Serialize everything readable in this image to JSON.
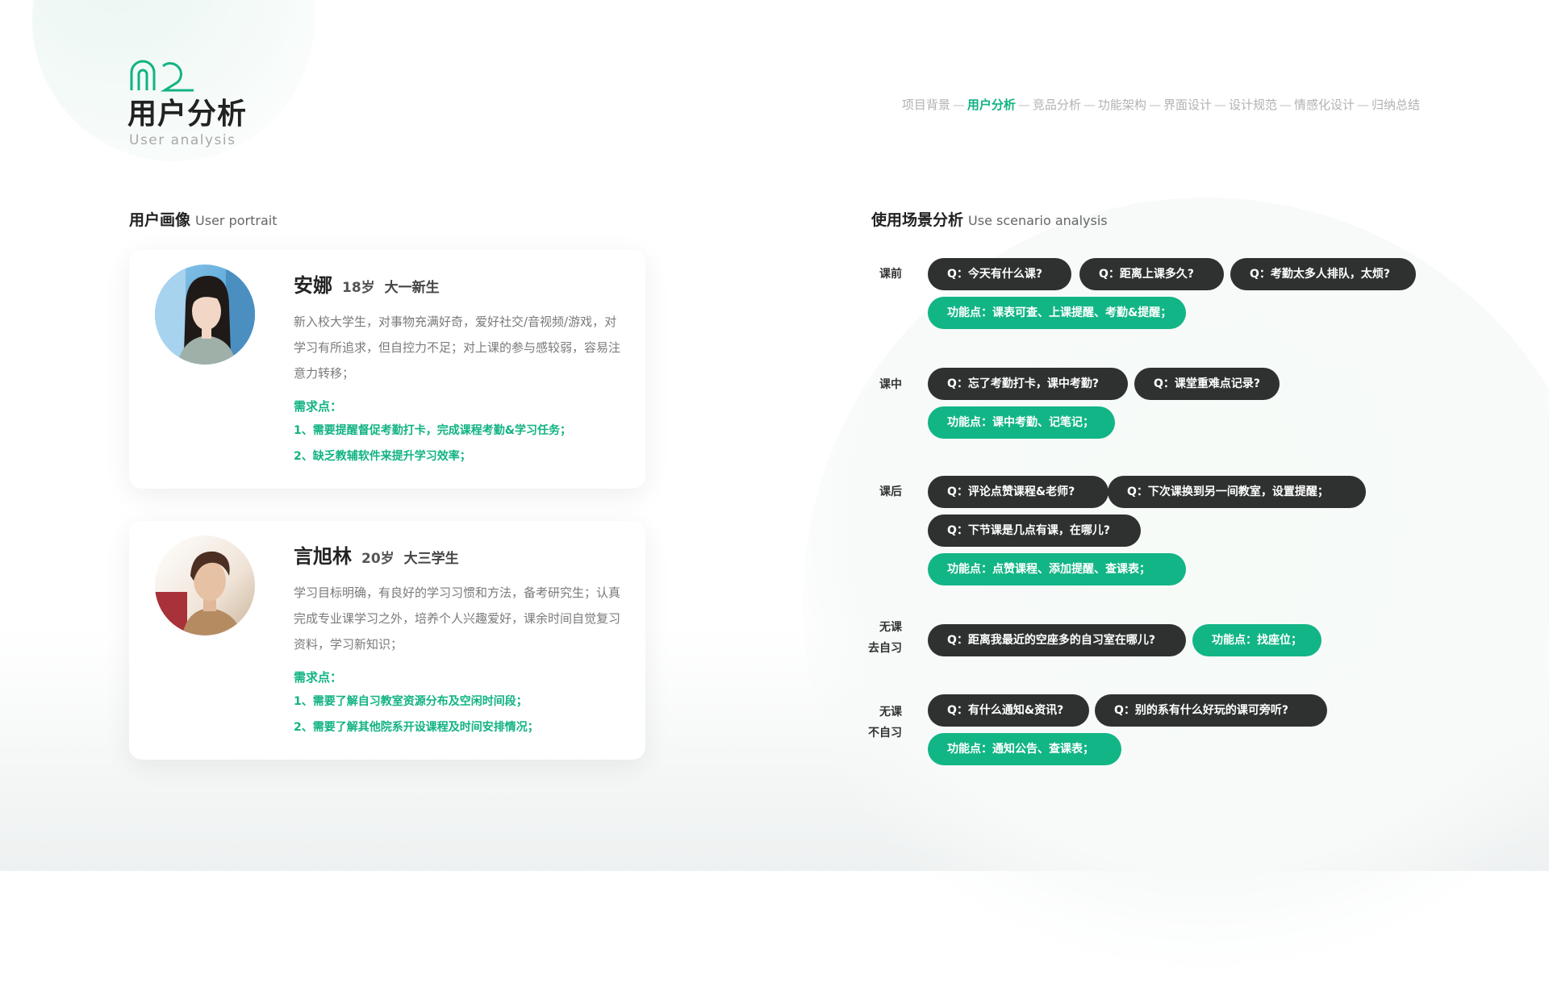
{
  "section": {
    "number": "02",
    "title": "用户分析",
    "subtitle": "User analysis"
  },
  "nav": {
    "items": [
      "项目背景",
      "用户分析",
      "竞品分析",
      "功能架构",
      "界面设计",
      "设计规范",
      "情感化设计",
      "归纳总结"
    ],
    "active": "用户分析",
    "separator": "—"
  },
  "portrait": {
    "title": "用户画像",
    "title_en": "User portrait",
    "users": [
      {
        "name": "安娜",
        "age": "18岁",
        "grade": "大一新生",
        "desc": "新入校大学生，对事物充满好奇，爱好社交/音视频/游戏，对学习有所追求，但自控力不足；对上课的参与感较弱，容易注意力转移；",
        "needs_title": "需求点：",
        "needs": [
          "1、需要提醒督促考勤打卡，完成课程考勤&学习任务；",
          "2、缺乏教辅软件来提升学习效率；"
        ]
      },
      {
        "name": "言旭林",
        "age": "20岁",
        "grade": "大三学生",
        "desc": "学习目标明确，有良好的学习习惯和方法，备考研究生；认真完成专业课学习之外，培养个人兴趣爱好，课余时间自觉复习资料，学习新知识；",
        "needs_title": "需求点：",
        "needs": [
          "1、需要了解自习教室资源分布及空闲时间段；",
          "2、需要了解其他院系开设课程及时间安排情况；"
        ]
      }
    ]
  },
  "scenario": {
    "title": "使用场景分析",
    "title_en": "Use scenario analysis",
    "groups": [
      {
        "label": [
          "课前"
        ],
        "questions": [
          "Q：今天有什么课?",
          "Q：距离上课多久?",
          "Q：考勤太多人排队，太烦?"
        ],
        "feature": "功能点：课表可查、上课提醒、考勤&提醒；"
      },
      {
        "label": [
          "课中"
        ],
        "questions": [
          "Q：忘了考勤打卡，课中考勤?",
          "Q：课堂重难点记录?"
        ],
        "feature": "功能点：课中考勤、记笔记；"
      },
      {
        "label": [
          "课后"
        ],
        "questions": [
          "Q：评论点赞课程&老师?",
          "Q：下次课换到另一间教室，设置提醒；",
          "Q：下节课是几点有课，在哪儿?"
        ],
        "feature": "功能点：点赞课程、添加提醒、查课表；"
      },
      {
        "label": [
          "无课",
          "去自习"
        ],
        "questions": [
          "Q：距离我最近的空座多的自习室在哪儿?"
        ],
        "feature": "功能点：找座位；"
      },
      {
        "label": [
          "无课",
          "不自习"
        ],
        "questions": [
          "Q：有什么通知&资讯?",
          "Q：别的系有什么好玩的课可旁听?"
        ],
        "feature": "功能点：通知公告、查课表；"
      }
    ]
  },
  "colors": {
    "accent": "#11b383",
    "pill_dark": "#2f3131",
    "pill_green": "#12b586",
    "text_main": "#222222",
    "text_muted": "#7a7a7a"
  }
}
